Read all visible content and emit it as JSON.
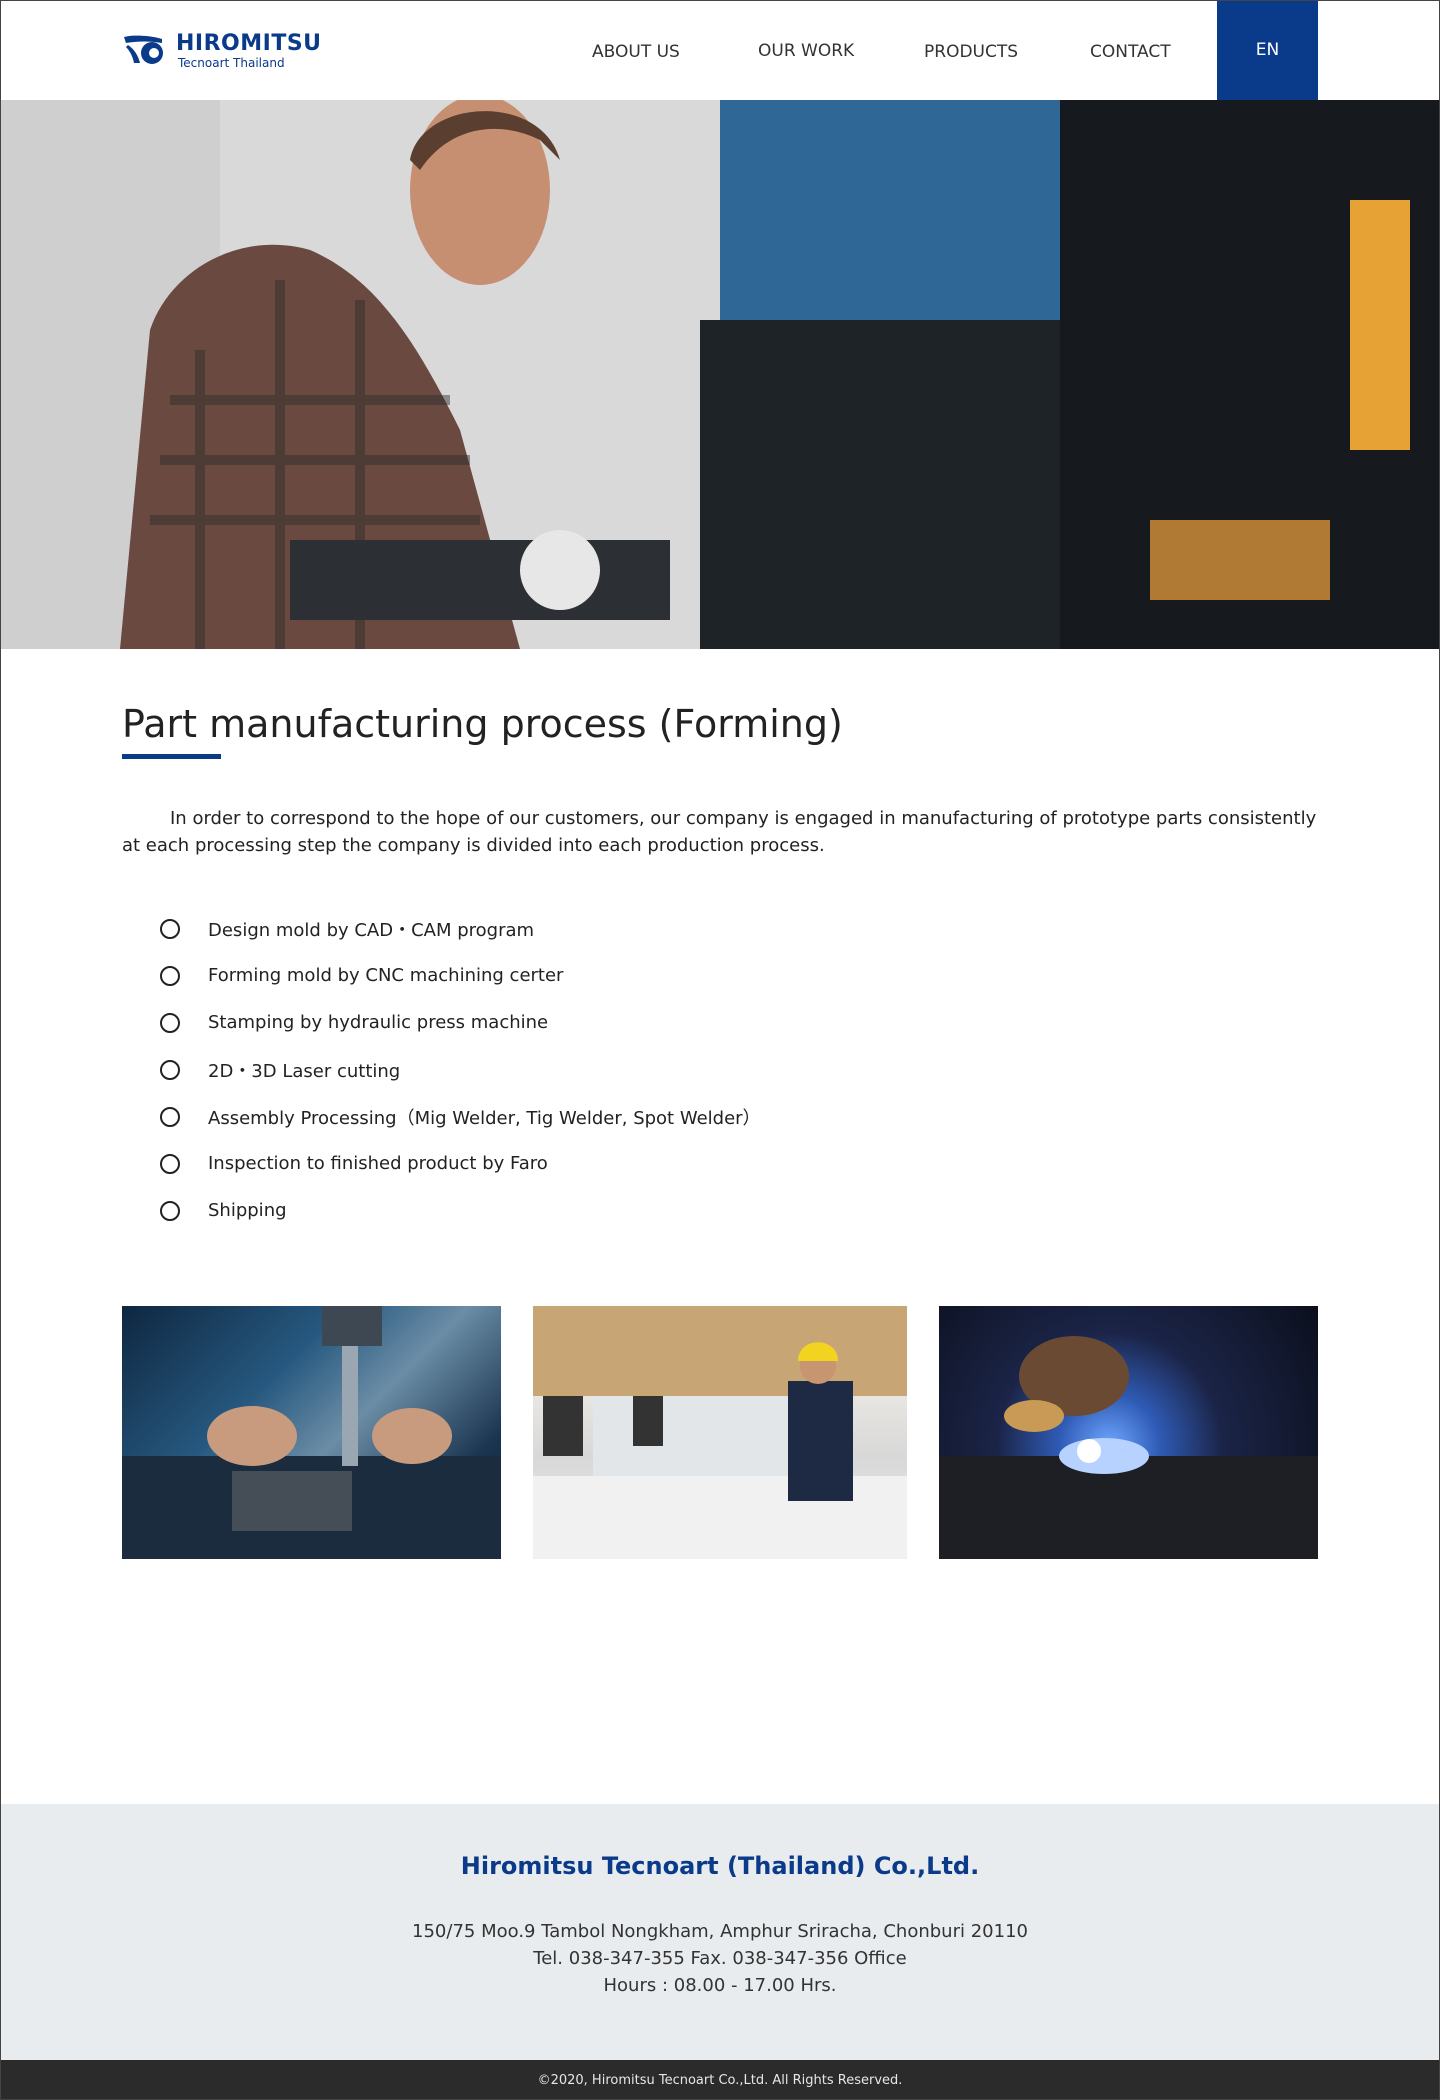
{
  "header": {
    "logo": {
      "name": "HIROMITSU",
      "sub": "Tecnoart Thailand"
    },
    "nav": [
      {
        "label": "ABOUT US"
      },
      {
        "label": "OUR WORK"
      },
      {
        "label": "PRODUCTS"
      },
      {
        "label": "CONTACT"
      }
    ],
    "language": "EN"
  },
  "main": {
    "title": "Part manufacturing process (Forming)",
    "intro": "In order to correspond to the hope of our customers, our company is engaged in manufacturing of prototype parts consistently at each processing step the company is divided into each production process.",
    "process_steps": [
      "Design mold by CAD・CAM program",
      "Forming mold by CNC machining certer",
      "Stamping by hydraulic press machine",
      "2D・3D Laser cutting",
      "Assembly Processing（Mig Welder, Tig Welder, Spot Welder）",
      "Inspection to finished product by Faro",
      "Shipping"
    ]
  },
  "footer": {
    "company": "Hiromitsu Tecnoart (Thailand) Co.,Ltd.",
    "address": "150/75 Moo.9 Tambol Nongkham, Amphur Sriracha, Chonburi 20110",
    "phone": "Tel. 038-347-355  Fax. 038-347-356 Office",
    "hours": "Hours : 08.00 - 17.00 Hrs.",
    "copyright": "©2020, Hiromitsu Tecnoart Co.,Ltd. All Rights Reserved."
  },
  "colors": {
    "brand": "#0a3a8a",
    "footer_bg": "#e9ecef",
    "copyright_bg": "#2b2b2b"
  }
}
